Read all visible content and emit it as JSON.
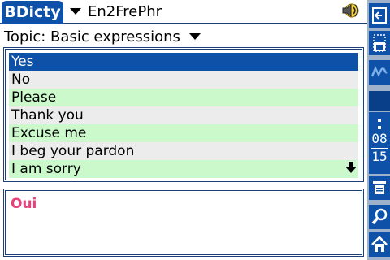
{
  "app": {
    "title": "BDicty",
    "dictionary": "En2FrePhr",
    "topic": "Topic: Basic expressions"
  },
  "list": {
    "items": [
      "Yes",
      "No",
      "Please",
      "Thank you",
      "Excuse me",
      "I beg your pardon",
      "I am sorry"
    ],
    "selected_index": 0
  },
  "translation": {
    "text": "Oui",
    "color": "#e8407a"
  },
  "system_bar": {
    "clock_hour": "08",
    "clock_minute": "15",
    "icons": [
      "exit-icon",
      "app-window-icon",
      "handwriting-icon",
      "clock-icon",
      "menu-icon",
      "find-icon",
      "home-icon"
    ]
  },
  "colors": {
    "accent": "#0e51a8",
    "row_alt_green": "#ccf9cc",
    "row_alt_gray": "#ececec",
    "sidebar": "#9eb2cc"
  },
  "icons": {
    "sound": "speaker-icon",
    "dropdown": "chevron-down-icon",
    "scroll": "scroll-down-arrow-icon"
  }
}
